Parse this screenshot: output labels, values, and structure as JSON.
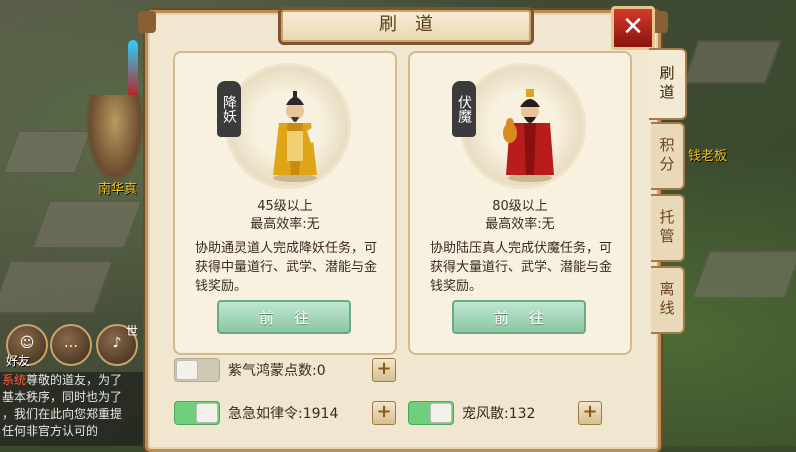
{
  "panel": {
    "title": "刷道",
    "close": "✕"
  },
  "tabs": [
    {
      "label": "刷道",
      "active": true
    },
    {
      "label": "积分",
      "active": false
    },
    {
      "label": "托管",
      "active": false
    },
    {
      "label": "离线",
      "active": false
    }
  ],
  "cards": [
    {
      "seal": "降妖",
      "level": "45级以上",
      "efficiency": "最高效率:无",
      "description": "协助通灵道人完成降妖任务，可获得中量道行、武学、潜能与金钱奖励。",
      "button": "前往"
    },
    {
      "seal": "伏魔",
      "level": "80级以上",
      "efficiency": "最高效率:无",
      "description": "协助陆压真人完成伏魔任务，可获得大量道行、武学、潜能与金钱奖励。",
      "button": "前往"
    }
  ],
  "options": [
    {
      "label": "紫气鸿蒙点数:0",
      "on": false
    },
    {
      "label": "急急如律令:1914",
      "on": true
    },
    {
      "label": "宠风散:132",
      "on": true
    }
  ],
  "plus": "+",
  "world": {
    "npc_left": "南华真",
    "npc_right": "钱老板",
    "friend": "好友",
    "voice": "世"
  },
  "chat": {
    "lines": [
      {
        "tag": "系统",
        "text": "尊敬的道友，为了"
      },
      {
        "tag": "",
        "text": "基本秩序，同时也为了"
      },
      {
        "tag": "",
        "text": "，我们在此向您郑重提"
      },
      {
        "tag": "",
        "text": "任何非官方认可的"
      }
    ]
  },
  "colors": {
    "accent_red": "#c01818",
    "go_green": "#8cc6a4",
    "toggle_on": "#6fcf7a"
  }
}
